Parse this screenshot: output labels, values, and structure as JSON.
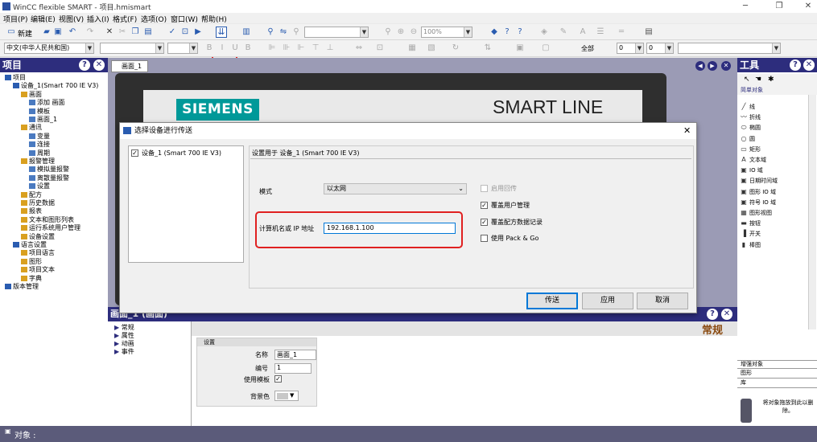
{
  "window": {
    "title": "WinCC flexible SMART - 项目.hmismart"
  },
  "menu": [
    "项目(P)",
    "编辑(E)",
    "视图(V)",
    "插入(I)",
    "格式(F)",
    "选项(O)",
    "窗口(W)",
    "帮助(H)"
  ],
  "toolbar": {
    "new_label": "新建",
    "zoom_value": "100%",
    "language_value": "中文(中华人民共和国)",
    "all_label": "全部",
    "spin_value1": "0",
    "spin_value2": "0"
  },
  "project_panel": {
    "title": "项目",
    "tree": [
      {
        "label": "项目",
        "level": 0
      },
      {
        "label": "设备_1(Smart 700 IE V3)",
        "level": 1
      },
      {
        "label": "画面",
        "level": 2
      },
      {
        "label": "添加 画面",
        "level": 3
      },
      {
        "label": "模板",
        "level": 3
      },
      {
        "label": "画面_1",
        "level": 3
      },
      {
        "label": "通讯",
        "level": 2
      },
      {
        "label": "变量",
        "level": 3
      },
      {
        "label": "连接",
        "level": 3
      },
      {
        "label": "周期",
        "level": 3
      },
      {
        "label": "报警管理",
        "level": 2
      },
      {
        "label": "模拟量报警",
        "level": 3
      },
      {
        "label": "离散量报警",
        "level": 3
      },
      {
        "label": "设置",
        "level": 3
      },
      {
        "label": "配方",
        "level": 2
      },
      {
        "label": "历史数据",
        "level": 2
      },
      {
        "label": "报表",
        "level": 2
      },
      {
        "label": "文本和图形列表",
        "level": 2
      },
      {
        "label": "运行系统用户管理",
        "level": 2
      },
      {
        "label": "设备设置",
        "level": 2
      },
      {
        "label": "语言设置",
        "level": 1
      },
      {
        "label": "项目语言",
        "level": 2
      },
      {
        "label": "图形",
        "level": 2
      },
      {
        "label": "项目文本",
        "level": 2
      },
      {
        "label": "字典",
        "level": 2
      },
      {
        "label": "版本管理",
        "level": 0
      }
    ]
  },
  "editor_tab": "画面_1",
  "screen": {
    "brand": "SIEMENS",
    "product": "SMART LINE"
  },
  "tools_panel": {
    "title": "工具",
    "section_simple": "简单对象",
    "items": [
      "线",
      "折线",
      "椭圆",
      "圆",
      "矩形",
      "文本域",
      "IO 域",
      "日期时间域",
      "图形 IO 域",
      "符号 IO 域",
      "图形视图",
      "按钮",
      "开关",
      "棒图"
    ],
    "sections": [
      "增强对象",
      "图形",
      "库"
    ],
    "library_hint": "将对象拖放到此以删除。"
  },
  "dialog": {
    "title": "选择设备进行传送",
    "device_item": "设备_1 (Smart 700 IE V3)",
    "settings_for": "设置用于 设备_1 (Smart 700 IE V3)",
    "mode_label": "模式",
    "mode_value": "以太网",
    "ip_label": "计算机名或 IP 地址",
    "ip_value": "192.168.1.100",
    "opt_backtransfer": "启用回传",
    "opt_overwrite_users": "覆盖用户管理",
    "opt_overwrite_recipes": "覆盖配方数据记录",
    "opt_packgo": "使用 Pack & Go",
    "btn_transfer": "传送",
    "btn_apply": "应用",
    "btn_cancel": "取消"
  },
  "properties": {
    "title": "画面_1 (画面)",
    "nav": [
      "常规",
      "属性",
      "动画",
      "事件"
    ],
    "heading": "常规",
    "group": "设置",
    "name_label": "名称",
    "name_value": "画面_1",
    "number_label": "编号",
    "number_value": "1",
    "template_label": "使用模板",
    "bg_label": "背景色"
  },
  "status": {
    "label": "对象 :"
  }
}
